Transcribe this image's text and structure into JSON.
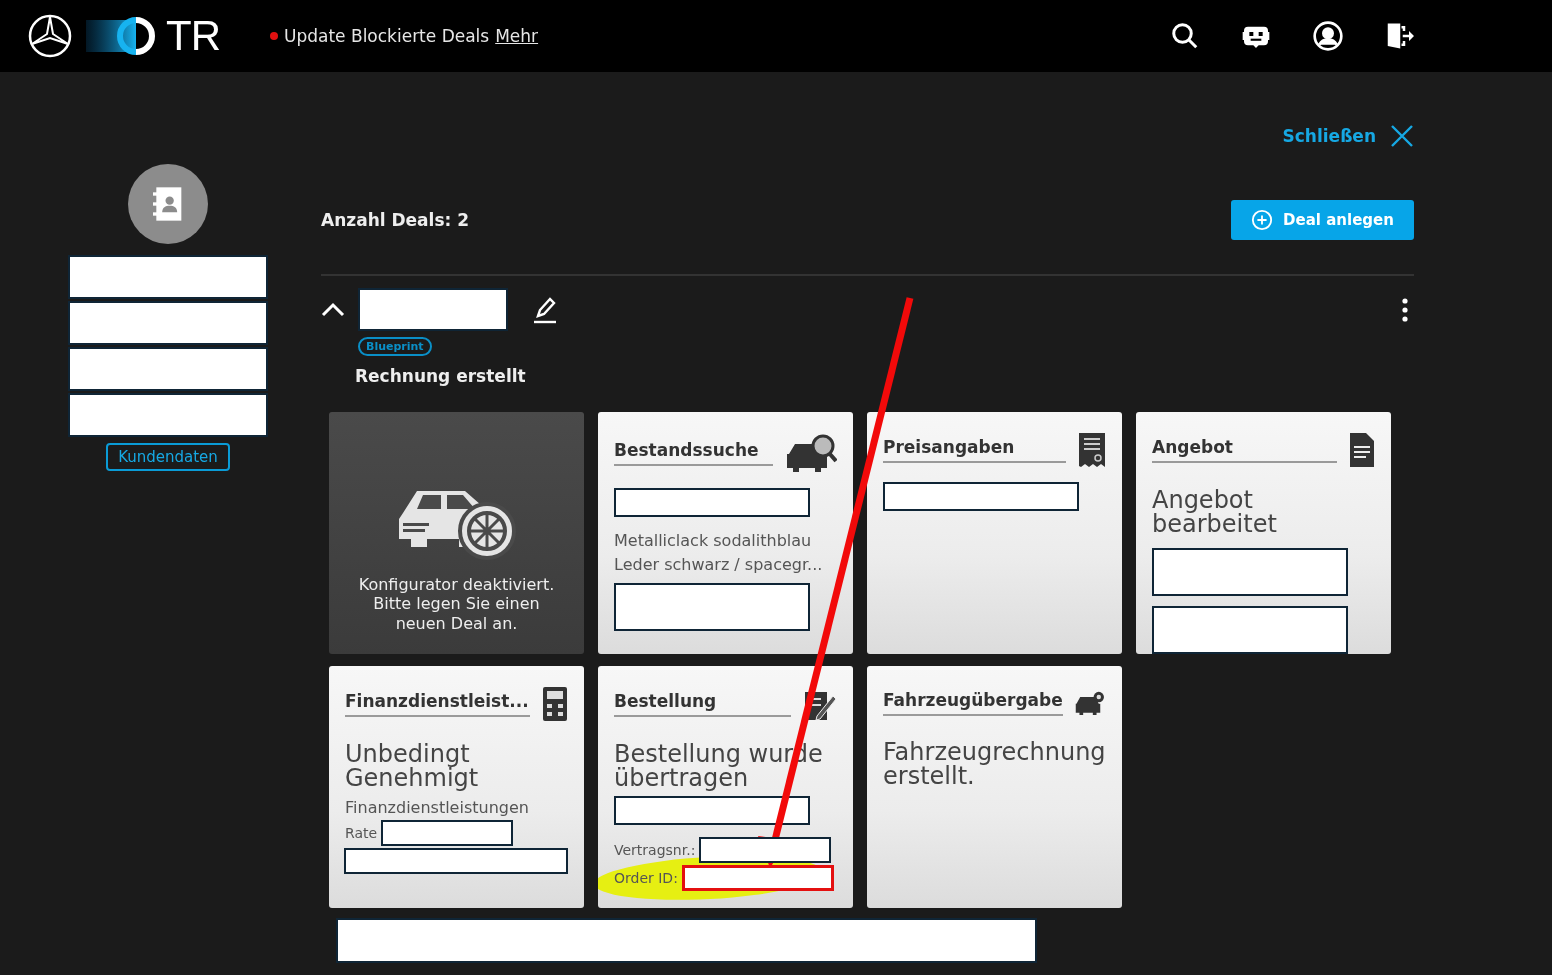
{
  "header": {
    "logo_text": "TR",
    "notice": {
      "text": "Update Blockierte Deals",
      "link": "Mehr"
    }
  },
  "customer": {
    "fields": [
      {
        "kind": "redacted"
      },
      {
        "kind": "redacted"
      },
      {
        "kind": "redacted"
      },
      {
        "kind": "redacted"
      }
    ],
    "button": "Kundendaten"
  },
  "close": "Schließen",
  "deal_count": "Anzahl Deals: 2",
  "new_deal_button": "Deal anlegen",
  "deal": {
    "expanded": true,
    "badge": "Blueprint",
    "status": "Rechnung erstellt",
    "cards": [
      {
        "kind": "disabled",
        "message": "Konfigurator deaktiviert. Bitte legen Sie einen neuen Deal an."
      },
      {
        "kind": "step",
        "title": "Bestandssuche",
        "items": [
          {
            "kind": "redacted"
          },
          {
            "kind": "note",
            "text": "Metalliclack sodalithblau"
          },
          {
            "kind": "note",
            "text": "Leder schwarz / spacegr..."
          },
          {
            "kind": "redacted_tall"
          }
        ]
      },
      {
        "kind": "step",
        "title": "Preisangaben",
        "items": [
          {
            "kind": "redacted"
          }
        ]
      },
      {
        "kind": "step",
        "title": "Angebot",
        "items": [
          {
            "kind": "status",
            "text": "Angebot bearbeitet"
          },
          {
            "kind": "redacted_tall"
          },
          {
            "kind": "redacted_tall"
          }
        ]
      },
      {
        "kind": "step",
        "title": "Finanzdienstleist...",
        "items": [
          {
            "kind": "status",
            "text": "Unbedingt Genehmigt"
          },
          {
            "kind": "note",
            "text": "Finanzdienstleistungen"
          },
          {
            "kind": "labeled",
            "label": "Rate",
            "highlighted": false
          },
          {
            "kind": "redacted_full"
          }
        ]
      },
      {
        "kind": "step",
        "title": "Bestellung",
        "items": [
          {
            "kind": "status",
            "text": "Bestellung wurde übertragen"
          },
          {
            "kind": "redacted"
          },
          {
            "kind": "labeled",
            "label": "Vertragsnr.:",
            "highlighted": false
          },
          {
            "kind": "labeled",
            "label": "Order ID:",
            "highlighted": true
          }
        ]
      },
      {
        "kind": "step",
        "title": "Fahrzeugübergabe",
        "items": [
          {
            "kind": "status",
            "text": "Fahrzeugrechnung erstellt."
          }
        ]
      }
    ],
    "footer": [
      {
        "kind": "redacted"
      }
    ]
  }
}
